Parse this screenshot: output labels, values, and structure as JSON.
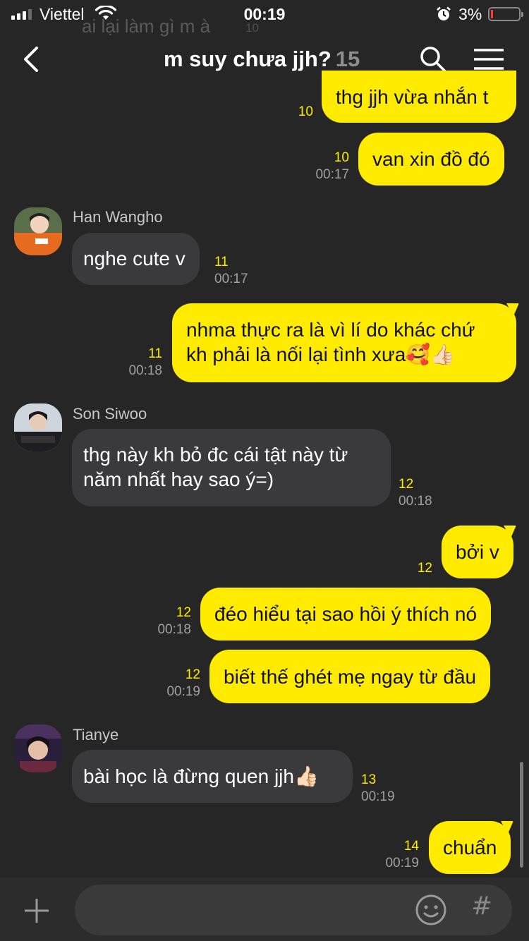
{
  "status_bar": {
    "carrier": "Viettel",
    "time": "00:19",
    "battery_percent": "3%",
    "battery_level": 0.03,
    "signal_bars_active": 3,
    "signal_bars_total": 4
  },
  "ghost": {
    "text": "ai lại làm gì m à",
    "number": "10"
  },
  "header": {
    "title": "m suy chưa jjh?",
    "member_count": "15"
  },
  "colors": {
    "my_bubble": "#ffeb00",
    "their_bubble": "#3a3a3c",
    "background": "#262626",
    "unread": "#ffeb00"
  },
  "messages": [
    {
      "from": "me",
      "text": "thg jjh vừa nhắn t",
      "unread": "10",
      "time": ""
    },
    {
      "from": "me",
      "text": "van xin đồ đó",
      "unread": "10",
      "time": "00:17"
    },
    {
      "from": "Han Wangho",
      "sender": "Han Wangho",
      "text": "nghe cute v",
      "unread": "11",
      "time": "00:17"
    },
    {
      "from": "me",
      "lines": [
        "nhma thực ra là vì lí do khác chứ",
        "kh phải là nối lại tình xưa🥰👍🏻"
      ],
      "unread": "11",
      "time": "00:18"
    },
    {
      "from": "Son Siwoo",
      "sender": "Son Siwoo",
      "lines": [
        "thg này kh bỏ đc cái tật này từ",
        "năm nhất hay sao ý=)"
      ],
      "unread": "12",
      "time": "00:18"
    },
    {
      "from": "me",
      "text": "bởi v",
      "unread": "12",
      "time": ""
    },
    {
      "from": "me",
      "text": "đéo hiểu tại sao hồi ý thích nó",
      "unread": "12",
      "time": "00:18"
    },
    {
      "from": "me",
      "text": "biết thế ghét mẹ ngay từ đầu",
      "unread": "12",
      "time": "00:19"
    },
    {
      "from": "Tianye",
      "sender": "Tianye",
      "text": "bài học là đừng quen jjh👍🏻",
      "unread": "13",
      "time": "00:19"
    },
    {
      "from": "me",
      "text": "chuẩn",
      "unread": "14",
      "time": "00:19"
    }
  ],
  "input": {
    "placeholder": "",
    "value": ""
  },
  "icons": {
    "back": "chevron-left-icon",
    "search": "search-icon",
    "menu": "hamburger-menu-icon",
    "plus": "plus-icon",
    "emoji": "emoji-icon",
    "hashtag": "hashtag-icon"
  },
  "hashtag_symbol": "#"
}
